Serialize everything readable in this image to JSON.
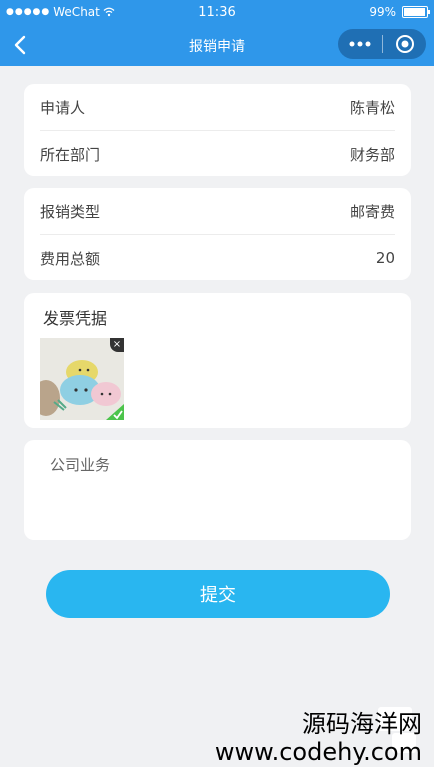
{
  "status_bar": {
    "carrier": "WeChat",
    "time": "11:36",
    "battery": "99%",
    "battery_level": 0.99
  },
  "nav": {
    "title": "报销申请",
    "more_icon": "more-dots-icon",
    "close_icon": "target-circle-icon",
    "back_icon": "chevron-left-icon"
  },
  "applicant": {
    "label": "申请人",
    "value": "陈青松"
  },
  "department": {
    "label": "所在部门",
    "value": "财务部"
  },
  "reimburse_type": {
    "label": "报销类型",
    "value": "邮寄费"
  },
  "total_amount": {
    "label": "费用总额",
    "value": "20"
  },
  "invoice": {
    "title": "发票凭据"
  },
  "notes": {
    "placeholder": "公司业务"
  },
  "submit_label": "提交",
  "watermark": {
    "line1": "源码海洋网",
    "line2": "www.codehy.com"
  },
  "colors": {
    "header": "#2f97ea",
    "button": "#29b6f0",
    "background": "#f0f1f3"
  }
}
